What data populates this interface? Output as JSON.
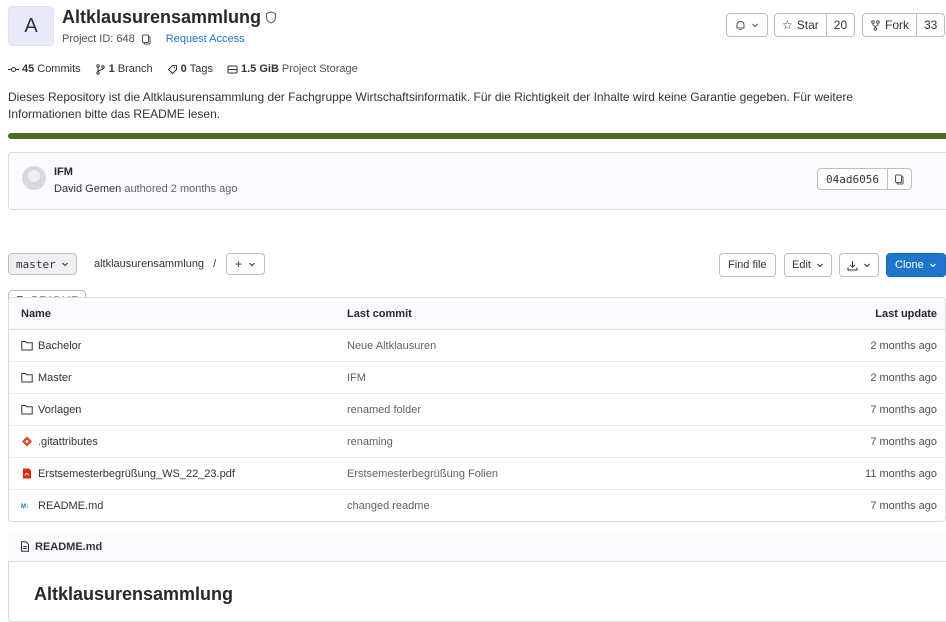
{
  "project": {
    "avatar_letter": "A",
    "name": "Altklausurensammlung",
    "id_label": "Project ID: 648",
    "request_access": "Request Access"
  },
  "actions": {
    "star_label": "Star",
    "star_count": "20",
    "fork_label": "Fork",
    "fork_count": "33"
  },
  "stats": {
    "commits_count": "45",
    "commits_label": "Commits",
    "branch_count": "1",
    "branch_label": "Branch",
    "tags_count": "0",
    "tags_label": "Tags",
    "storage_value": "1.5 GiB",
    "storage_label": "Project Storage"
  },
  "description": "Dieses Repository ist die Altklausurensammlung der Fachgruppe Wirtschaftsinformatik. Für die Richtigkeit der Inhalte wird keine Garantie gegeben. Für weitere Informationen bitte das README lesen.",
  "last_commit": {
    "title": "IFM",
    "author": "David Gemen",
    "meta": " authored 2 months ago",
    "sha": "04ad6056"
  },
  "toolbar": {
    "branch": "master",
    "path": "altklausurensammlung",
    "path_sep": "/",
    "plus": "+",
    "find_file": "Find file",
    "edit": "Edit",
    "clone": "Clone",
    "readme_button": "README"
  },
  "files": {
    "headers": {
      "name": "Name",
      "commit": "Last commit",
      "update": "Last update"
    },
    "rows": [
      {
        "name": "Bachelor",
        "icon": "folder-icon",
        "commit": "Neue Altklausuren",
        "date": "2 months ago"
      },
      {
        "name": "Master",
        "icon": "folder-icon",
        "commit": "IFM",
        "date": "2 months ago"
      },
      {
        "name": "Vorlagen",
        "icon": "folder-icon",
        "commit": "renamed folder",
        "date": "7 months ago"
      },
      {
        "name": ".gitattributes",
        "icon": "git-icon",
        "commit": "renaming",
        "date": "7 months ago"
      },
      {
        "name": "Erstsemesterbegrüßung_WS_22_23.pdf",
        "icon": "pdf-icon",
        "commit": "Erstsemesterbegrüßung Folien",
        "date": "11 months ago"
      },
      {
        "name": "README.md",
        "icon": "markdown-icon",
        "commit": "changed readme",
        "date": "7 months ago"
      }
    ]
  },
  "readme": {
    "file_label": "README.md",
    "heading": "Altklausurensammlung"
  },
  "colors": {
    "accent": "#1f75cb",
    "language_bar": "#4d6b22",
    "git_icon": "#e24329",
    "pdf_icon": "#dd2b0e"
  }
}
